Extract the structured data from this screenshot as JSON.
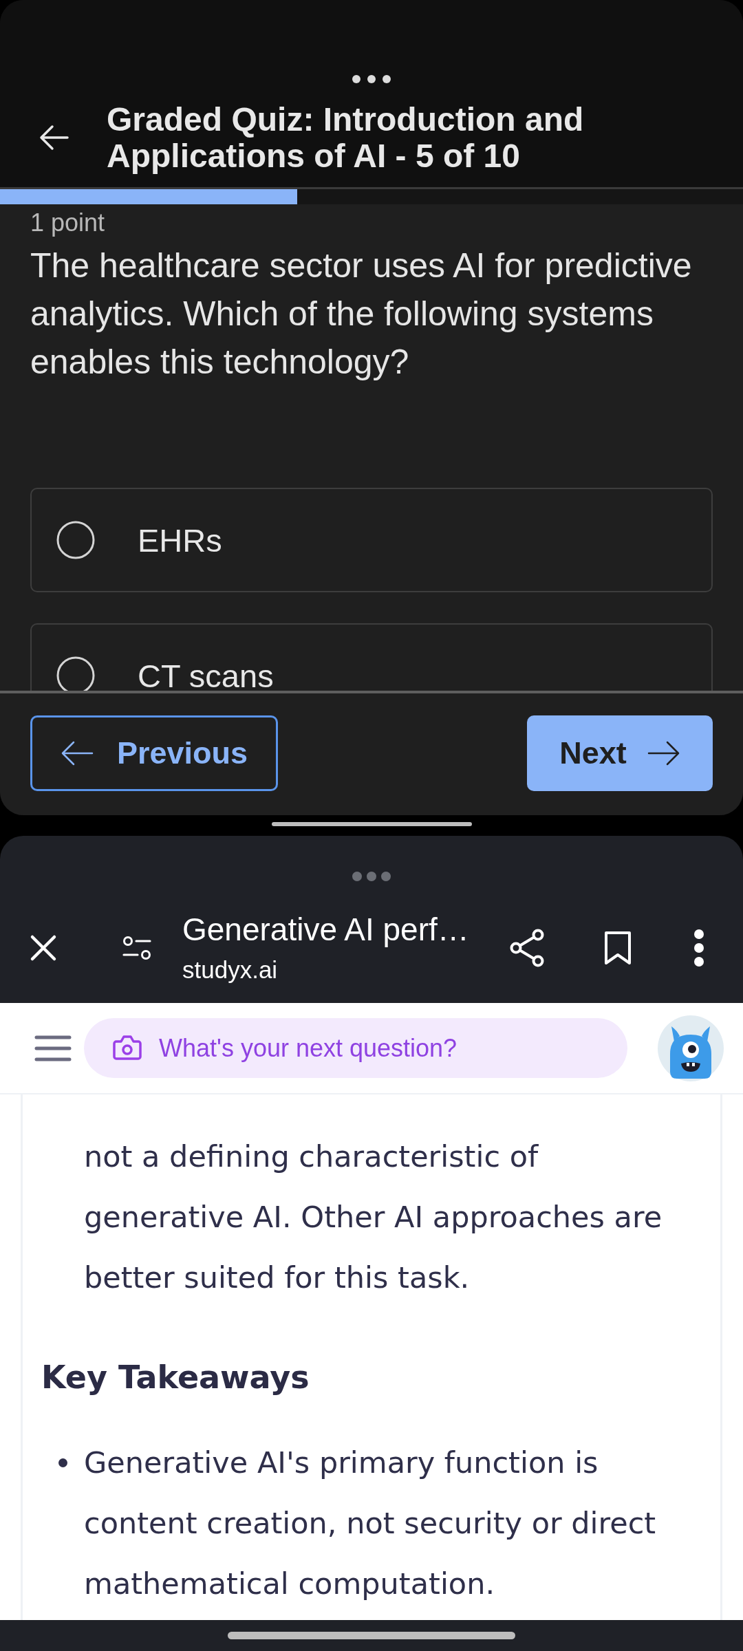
{
  "quiz_window": {
    "title": "Graded Quiz: Introduction and Applications of AI - 5 of 10",
    "progress": {
      "level": 0.4
    },
    "points": "1 point",
    "question": "The healthcare sector uses AI for predictive analytics. Which of the following systems enables this technology?",
    "options": [
      {
        "label": "EHRs",
        "selected": false
      },
      {
        "label": "CT scans",
        "selected": false
      }
    ],
    "previous_button": "Previous",
    "next_button": "Next"
  },
  "browser_window": {
    "page_title": "Generative AI perf…",
    "domain": "studyx.ai",
    "search": {
      "placeholder": "What's your next question?"
    },
    "article": {
      "paragraph": "not a defining characteristic of generative AI. Other AI approaches are better suited for this task.",
      "heading": "Key Takeaways",
      "bullets": [
        "Generative AI's primary function is content creation, not security or direct mathematical computation."
      ]
    }
  }
}
